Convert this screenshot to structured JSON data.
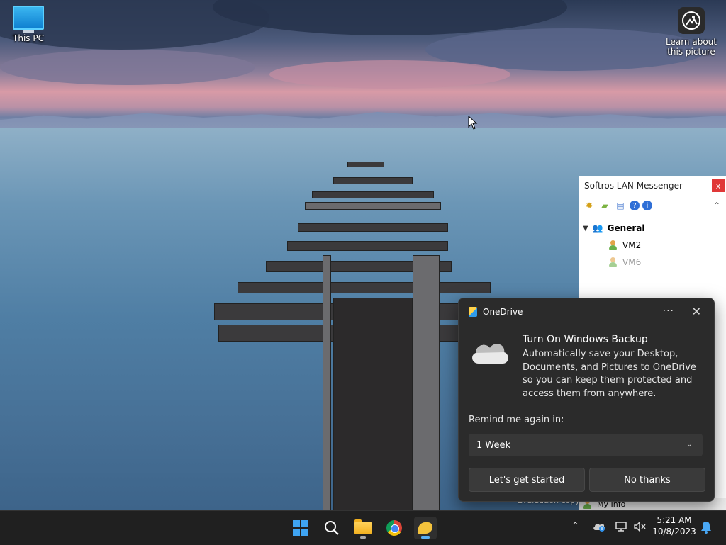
{
  "desktop": {
    "this_pc_label": "This PC",
    "learn_label_line1": "Learn about",
    "learn_label_line2": "this picture",
    "evaluation_text": "Evaluation copy"
  },
  "messenger": {
    "title": "Softros LAN Messenger",
    "close_glyph": "x",
    "group_name": "General",
    "users": [
      {
        "name": "VM2",
        "online": true
      },
      {
        "name": "VM6",
        "online": false
      }
    ],
    "footer_label": "My Info"
  },
  "toast": {
    "app_name": "OneDrive",
    "more_glyph": "···",
    "close_glyph": "✕",
    "title": "Turn On Windows Backup",
    "body": "Automatically save your Desktop, Documents, and Pictures to OneDrive so you can keep them protected and access them from anywhere.",
    "remind_label": "Remind me again in:",
    "remind_value": "1 Week",
    "primary_button": "Let's get started",
    "secondary_button": "No thanks"
  },
  "taskbar": {
    "time": "5:21 AM",
    "date": "10/8/2023",
    "icons": [
      "windows-start-icon",
      "search-icon",
      "file-explorer-icon",
      "chrome-icon",
      "softros-messenger-icon"
    ],
    "tray_icons": [
      "chevron-up-icon",
      "onedrive-icon",
      "network-icon",
      "volume-muted-icon",
      "notification-bell-icon"
    ]
  },
  "colors": {
    "taskbar_bg": "#202020",
    "toast_bg": "#2b2b2b",
    "accent": "#5ab0f5"
  }
}
